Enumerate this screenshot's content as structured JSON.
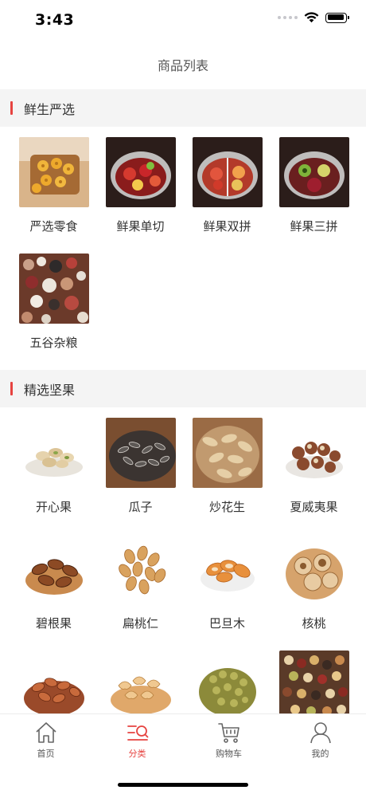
{
  "status_bar": {
    "time": "3:43"
  },
  "nav": {
    "title": "商品列表"
  },
  "sections": [
    {
      "title": "鲜生严选",
      "items": [
        {
          "label": "严选零食",
          "image": "snack-cookies-image"
        },
        {
          "label": "鲜果单切",
          "image": "fruit-bowl-image"
        },
        {
          "label": "鲜果双拼",
          "image": "fruit-bowl-image"
        },
        {
          "label": "鲜果三拼",
          "image": "fruit-bowl-image"
        },
        {
          "label": "五谷杂粮",
          "image": "mixed-grains-image"
        }
      ]
    },
    {
      "title": "精选坚果",
      "items": [
        {
          "label": "开心果",
          "image": "pistachio-image"
        },
        {
          "label": "瓜子",
          "image": "sunflower-seeds-image"
        },
        {
          "label": "炒花生",
          "image": "peanuts-image"
        },
        {
          "label": "夏威夷果",
          "image": "macadamia-image"
        },
        {
          "label": "碧根果",
          "image": "pecan-image"
        },
        {
          "label": "扁桃仁",
          "image": "almond-image"
        },
        {
          "label": "巴旦木",
          "image": "badam-image"
        },
        {
          "label": "核桃",
          "image": "walnut-image"
        },
        {
          "label": "",
          "image": "pine-nuts-image"
        },
        {
          "label": "",
          "image": "cashew-image"
        },
        {
          "label": "",
          "image": "raisins-image"
        },
        {
          "label": "",
          "image": "mixed-nuts-image"
        }
      ]
    }
  ],
  "tab_bar": {
    "tabs": [
      {
        "label": "首页",
        "icon": "home-icon"
      },
      {
        "label": "分类",
        "icon": "category-icon",
        "active": true
      },
      {
        "label": "购物车",
        "icon": "cart-icon"
      },
      {
        "label": "我的",
        "icon": "user-icon"
      }
    ]
  },
  "colors": {
    "accent": "#e64340",
    "section_bg": "#f4f4f4",
    "text": "#333333",
    "tab_inactive": "#555555"
  }
}
